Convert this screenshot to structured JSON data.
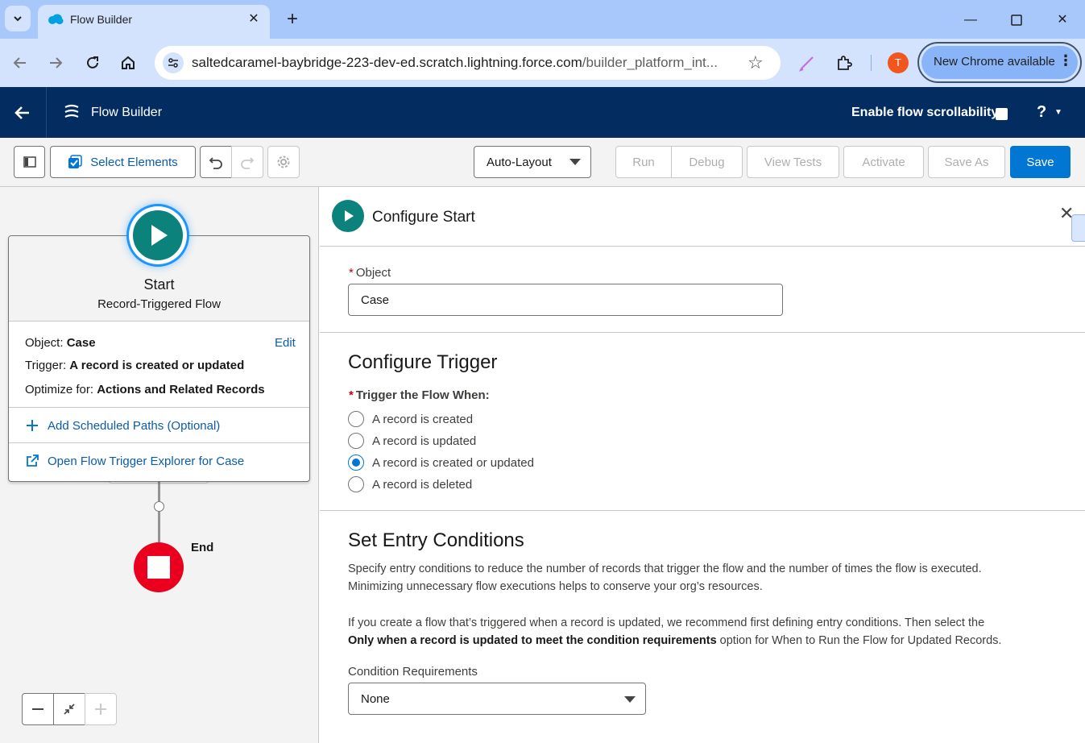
{
  "browser": {
    "tab_title": "Flow Builder",
    "url_main": "saltedcaramel-baybridge-223-dev-ed.scratch.lightning.force.com",
    "url_path": "/builder_platform_int...",
    "profile_initial": "T",
    "update_label": "New Chrome available"
  },
  "sf_header": {
    "title": "Flow Builder",
    "scroll_label": "Enable flow scrollability",
    "help": "?"
  },
  "toolbar": {
    "select_elements": "Select Elements",
    "layout_value": "Auto-Layout",
    "run": "Run",
    "debug": "Debug",
    "view_tests": "View Tests",
    "activate": "Activate",
    "save_as": "Save As",
    "save": "Save"
  },
  "canvas": {
    "start_title": "Start",
    "start_subtitle": "Record-Triggered Flow",
    "object_label": "Object:",
    "object_value": "Case",
    "edit": "Edit",
    "trigger_label": "Trigger:",
    "trigger_value": "A record is created or updated",
    "optimize_label": "Optimize for:",
    "optimize_value": "Actions and Related Records",
    "add_paths": "Add Scheduled Paths (Optional)",
    "open_explorer": "Open Flow Trigger Explorer for Case",
    "end_label": "End"
  },
  "panel": {
    "title": "Configure Start",
    "object_label": "Object",
    "object_value": "Case",
    "trigger_section": "Configure Trigger",
    "trigger_label": "Trigger the Flow When:",
    "options": [
      {
        "label": "A record is created",
        "checked": false
      },
      {
        "label": "A record is updated",
        "checked": false
      },
      {
        "label": "A record is created or updated",
        "checked": true
      },
      {
        "label": "A record is deleted",
        "checked": false
      }
    ],
    "entry_section": "Set Entry Conditions",
    "para1_line1": "Specify entry conditions to reduce the number of records that trigger the flow and the number of times the flow is executed.",
    "para1_line2": "Minimizing unnecessary flow executions helps to conserve your org’s resources.",
    "para2_line1": "If you create a flow that’s triggered when a record is updated, we recommend first defining entry conditions. Then select the",
    "para2_bold": "Only when a record is updated to meet the condition requirements",
    "para2_rest": " option for When to Run the Flow for Updated Records.",
    "cond_label": "Condition Requirements",
    "cond_value": "None"
  },
  "colors": {
    "sf_header": "#032d60",
    "brand_blue": "#0176d3",
    "start_teal": "#0b827c",
    "end_red": "#ea001e"
  }
}
